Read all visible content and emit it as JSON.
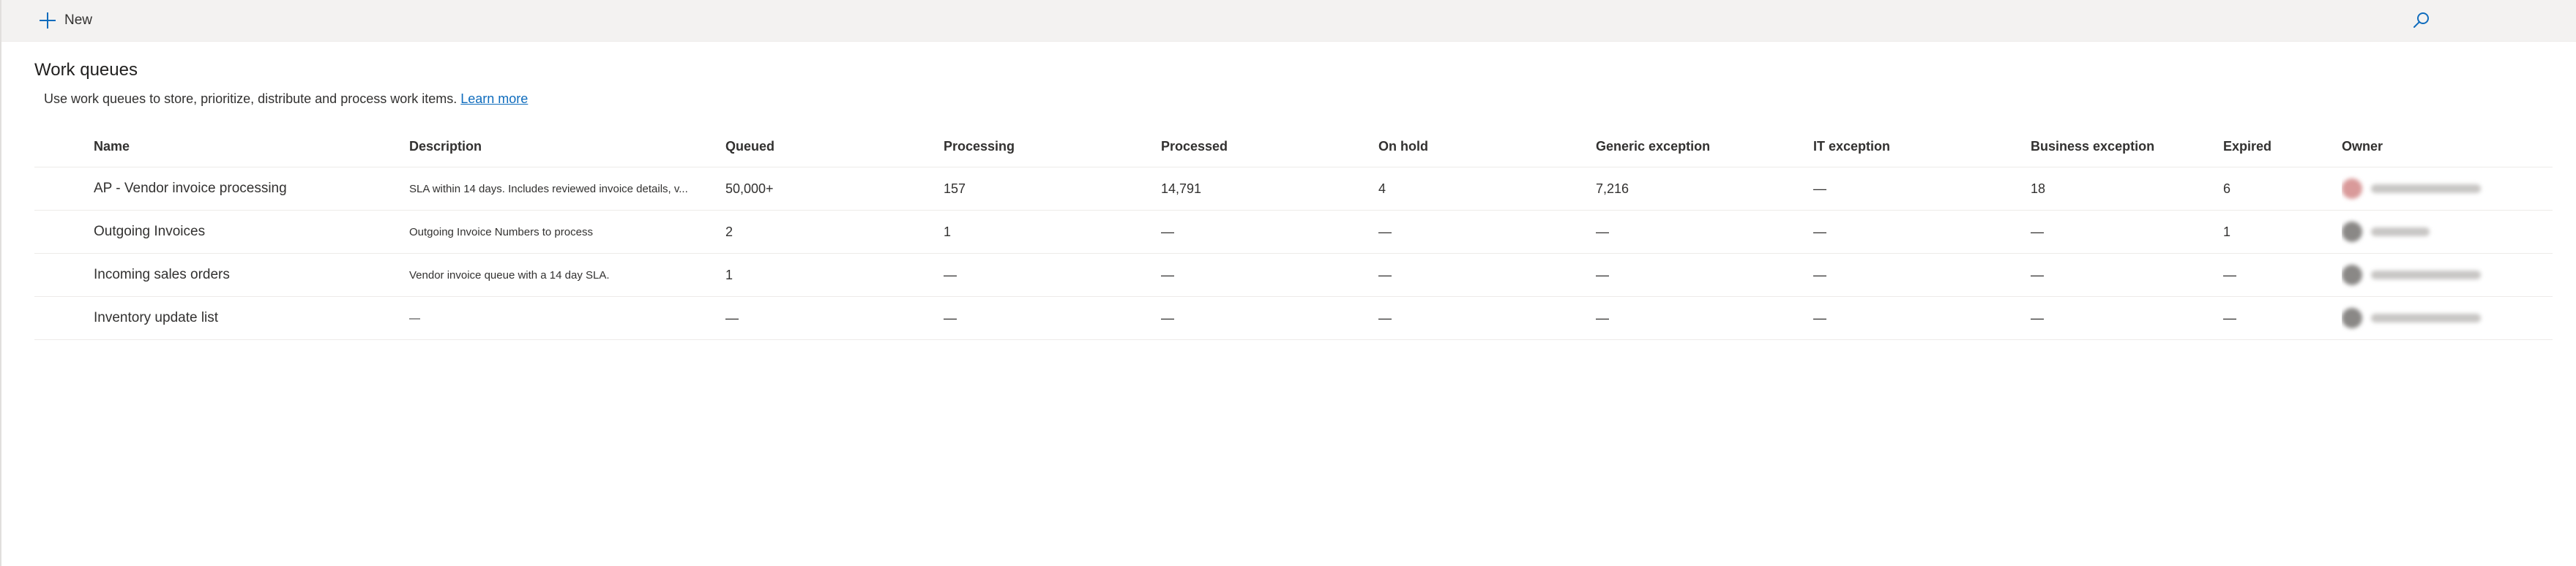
{
  "toolbar": {
    "new_label": "New",
    "new_icon": "plus-icon",
    "search_icon": "search-icon"
  },
  "header": {
    "title": "Work queues",
    "description": "Use work queues to store, prioritize, distribute and process work items.",
    "learn_more": "Learn more"
  },
  "table": {
    "columns": {
      "name": "Name",
      "description": "Description",
      "queued": "Queued",
      "processing": "Processing",
      "processed": "Processed",
      "on_hold": "On hold",
      "generic_exception": "Generic exception",
      "it_exception": "IT exception",
      "business_exception": "Business exception",
      "expired": "Expired",
      "owner": "Owner"
    },
    "rows": [
      {
        "name": "AP - Vendor invoice processing",
        "description": "SLA within 14 days. Includes reviewed invoice details, v...",
        "queued": "50,000+",
        "processing": "157",
        "processed": "14,791",
        "on_hold": "4",
        "generic_exception": "7,216",
        "it_exception": "—",
        "business_exception": "18",
        "expired": "6"
      },
      {
        "name": "Outgoing Invoices",
        "description": "Outgoing Invoice Numbers to process",
        "queued": "2",
        "processing": "1",
        "processed": "—",
        "on_hold": "—",
        "generic_exception": "—",
        "it_exception": "—",
        "business_exception": "—",
        "expired": "1"
      },
      {
        "name": "Incoming sales orders",
        "description": "Vendor invoice queue with a 14 day SLA.",
        "queued": "1",
        "processing": "—",
        "processed": "—",
        "on_hold": "—",
        "generic_exception": "—",
        "it_exception": "—",
        "business_exception": "—",
        "expired": "—"
      },
      {
        "name": "Inventory update list",
        "description": "—",
        "queued": "—",
        "processing": "—",
        "processed": "—",
        "on_hold": "—",
        "generic_exception": "—",
        "it_exception": "—",
        "business_exception": "—",
        "expired": "—"
      }
    ]
  },
  "colors": {
    "accent": "#0f6cbd",
    "command_bar": "#f3f2f1",
    "divider": "#edebe9"
  }
}
